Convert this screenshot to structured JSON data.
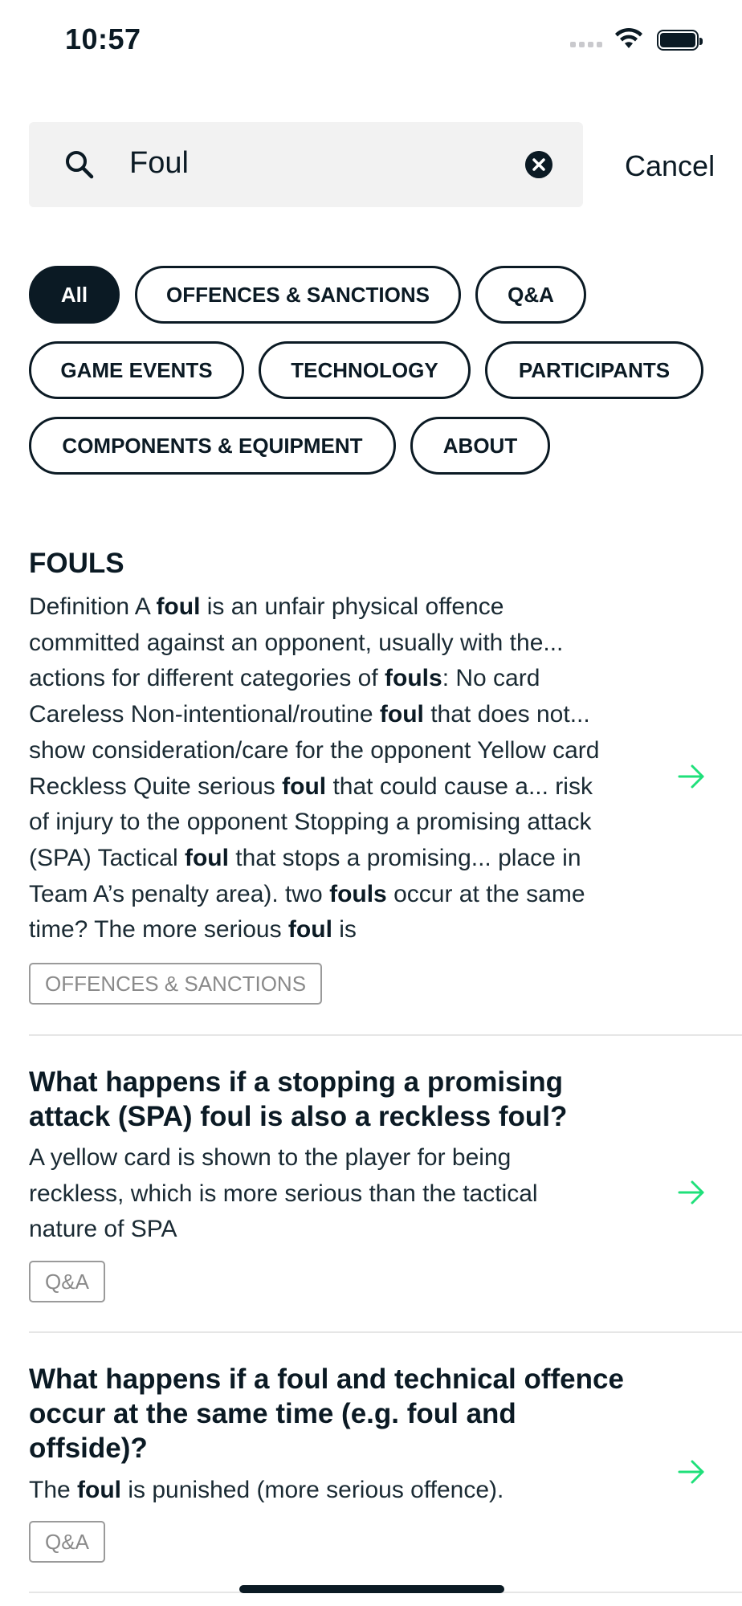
{
  "status": {
    "time": "10:57"
  },
  "search": {
    "value": "Foul",
    "cancel_label": "Cancel"
  },
  "filters": [
    {
      "label": "All",
      "active": true
    },
    {
      "label": "OFFENCES & SANCTIONS",
      "active": false
    },
    {
      "label": "Q&A",
      "active": false
    },
    {
      "label": "GAME EVENTS",
      "active": false
    },
    {
      "label": "TECHNOLOGY",
      "active": false
    },
    {
      "label": "PARTICIPANTS",
      "active": false
    },
    {
      "label": "COMPONENTS & EQUIPMENT",
      "active": false
    },
    {
      "label": "ABOUT",
      "active": false
    }
  ],
  "results": [
    {
      "title": "FOULS",
      "body_lines": [
        [
          [
            "Definition A ",
            false
          ],
          [
            "foul",
            true
          ],
          [
            " is an unfair physical offence",
            false
          ]
        ],
        [
          [
            "committed against an opponent, usually with the...",
            false
          ]
        ],
        [
          [
            "actions for different categories of ",
            false
          ],
          [
            "fouls",
            true
          ],
          [
            ": No card",
            false
          ]
        ],
        [
          [
            "Careless Non-intentional/routine ",
            false
          ],
          [
            "foul",
            true
          ],
          [
            " that does not...",
            false
          ]
        ],
        [
          [
            "show consideration/care for the opponent Yellow card",
            false
          ]
        ],
        [
          [
            "Reckless Quite serious ",
            false
          ],
          [
            "foul",
            true
          ],
          [
            " that could cause a...  risk",
            false
          ]
        ],
        [
          [
            "of injury to the opponent Stopping a promising attack",
            false
          ]
        ],
        [
          [
            "(SPA) Tactical ",
            false
          ],
          [
            "foul",
            true
          ],
          [
            " that stops a promising...  place in",
            false
          ]
        ],
        [
          [
            "Team A’s penalty area). two ",
            false
          ],
          [
            "fouls",
            true
          ],
          [
            " occur at the same",
            false
          ]
        ],
        [
          [
            "time? The more serious ",
            false
          ],
          [
            "foul",
            true
          ],
          [
            " is",
            false
          ]
        ]
      ],
      "tag": "OFFENCES & SANCTIONS"
    },
    {
      "title_lines": [
        "What happens if a stopping a promising",
        "attack (SPA) foul is also a reckless foul?"
      ],
      "body_lines": [
        [
          [
            "A yellow card is shown to the player for being",
            false
          ]
        ],
        [
          [
            "reckless, which is more serious than the tactical",
            false
          ]
        ],
        [
          [
            "nature of SPA",
            false
          ]
        ]
      ],
      "tag": "Q&A"
    },
    {
      "title_lines": [
        "What happens if a foul and technical offence",
        "occur at the same time (e.g. foul and",
        "offside)?"
      ],
      "body_lines": [
        [
          [
            "The ",
            false
          ],
          [
            "foul",
            true
          ],
          [
            " is punished (more serious offence).",
            false
          ]
        ]
      ],
      "tag": "Q&A"
    }
  ],
  "colors": {
    "dark": "#0b1a24",
    "accent_green": "#1fe07a",
    "search_bg": "#f2f2f2",
    "tag_gray": "#9a9a9a"
  },
  "icons": {
    "search": "search-icon",
    "clear": "clear-icon",
    "arrow": "arrow-right-icon"
  }
}
